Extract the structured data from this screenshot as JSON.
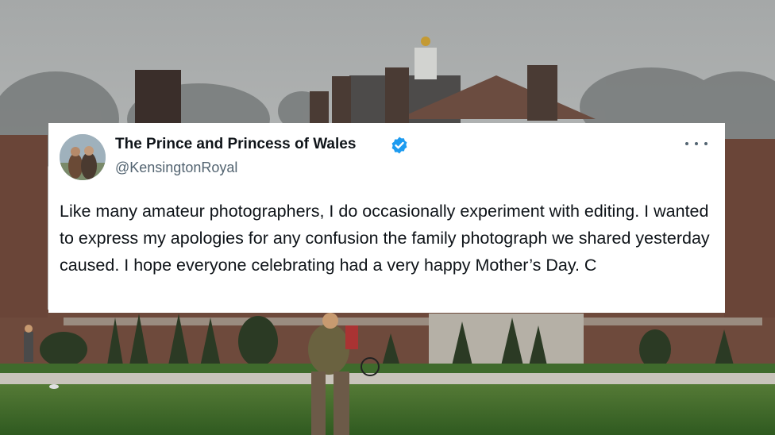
{
  "tweet": {
    "author_name": "The Prince and Princess of Wales",
    "handle": "@KensingtonRoyal",
    "verified": true,
    "verified_color": "#1d9bf0",
    "body": "Like many amateur photographers, I do occasionally experiment with editing. I wanted to express my apologies for any confusion the family photograph we shared yesterday caused. I hope everyone celebrating had a very happy Mother’s Day. C",
    "more_icon": "more-horizontal-icon"
  }
}
